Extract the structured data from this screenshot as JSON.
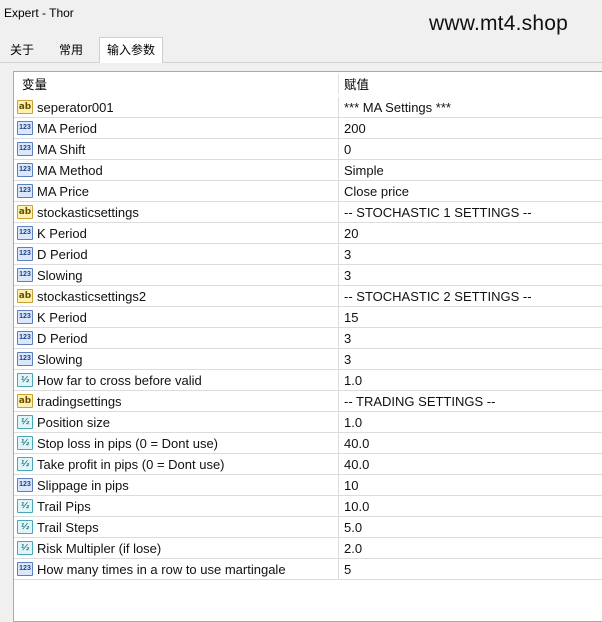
{
  "window": {
    "title": "Expert - Thor"
  },
  "watermark": "www.mt4.shop",
  "tabs": [
    {
      "label": "关于"
    },
    {
      "label": "常用"
    },
    {
      "label": "输入参数",
      "active": true
    }
  ],
  "table": {
    "columns": [
      "变量",
      "赋值"
    ],
    "rows": [
      {
        "type": "ab",
        "icon_text": "ab",
        "name": "seperator001",
        "value": "*** MA Settings ***"
      },
      {
        "type": "num",
        "icon_text": "123",
        "name": "MA Period",
        "value": "200"
      },
      {
        "type": "num",
        "icon_text": "123",
        "name": "MA Shift",
        "value": "0"
      },
      {
        "type": "num",
        "icon_text": "123",
        "name": "MA Method",
        "value": "Simple"
      },
      {
        "type": "num",
        "icon_text": "123",
        "name": "MA Price",
        "value": "Close price"
      },
      {
        "type": "ab",
        "icon_text": "ab",
        "name": "stockasticsettings",
        "value": "-- STOCHASTIC 1 SETTINGS --"
      },
      {
        "type": "num",
        "icon_text": "123",
        "name": "K Period",
        "value": "20"
      },
      {
        "type": "num",
        "icon_text": "123",
        "name": "D Period",
        "value": "3"
      },
      {
        "type": "num",
        "icon_text": "123",
        "name": "Slowing",
        "value": "3"
      },
      {
        "type": "ab",
        "icon_text": "ab",
        "name": "stockasticsettings2",
        "value": "-- STOCHASTIC 2 SETTINGS --"
      },
      {
        "type": "num",
        "icon_text": "123",
        "name": "K Period",
        "value": "15"
      },
      {
        "type": "num",
        "icon_text": "123",
        "name": "D Period",
        "value": "3"
      },
      {
        "type": "num",
        "icon_text": "123",
        "name": "Slowing",
        "value": "3"
      },
      {
        "type": "dbl",
        "icon_text": "½",
        "name": "How far to cross before valid",
        "value": "1.0"
      },
      {
        "type": "ab",
        "icon_text": "ab",
        "name": "tradingsettings",
        "value": "-- TRADING SETTINGS --"
      },
      {
        "type": "dbl",
        "icon_text": "½",
        "name": "Position size",
        "value": "1.0"
      },
      {
        "type": "dbl",
        "icon_text": "½",
        "name": "Stop loss in pips (0 = Dont use)",
        "value": "40.0"
      },
      {
        "type": "dbl",
        "icon_text": "½",
        "name": "Take profit in pips (0 = Dont use)",
        "value": "40.0"
      },
      {
        "type": "num",
        "icon_text": "123",
        "name": "Slippage in pips",
        "value": "10"
      },
      {
        "type": "dbl",
        "icon_text": "½",
        "name": "Trail Pips",
        "value": "10.0"
      },
      {
        "type": "dbl",
        "icon_text": "½",
        "name": "Trail Steps",
        "value": "5.0"
      },
      {
        "type": "dbl",
        "icon_text": "½",
        "name": "Risk Multipler (if lose)",
        "value": "2.0"
      },
      {
        "type": "num",
        "icon_text": "123",
        "name": "How many times in a row to use martingale",
        "value": "5"
      }
    ]
  }
}
